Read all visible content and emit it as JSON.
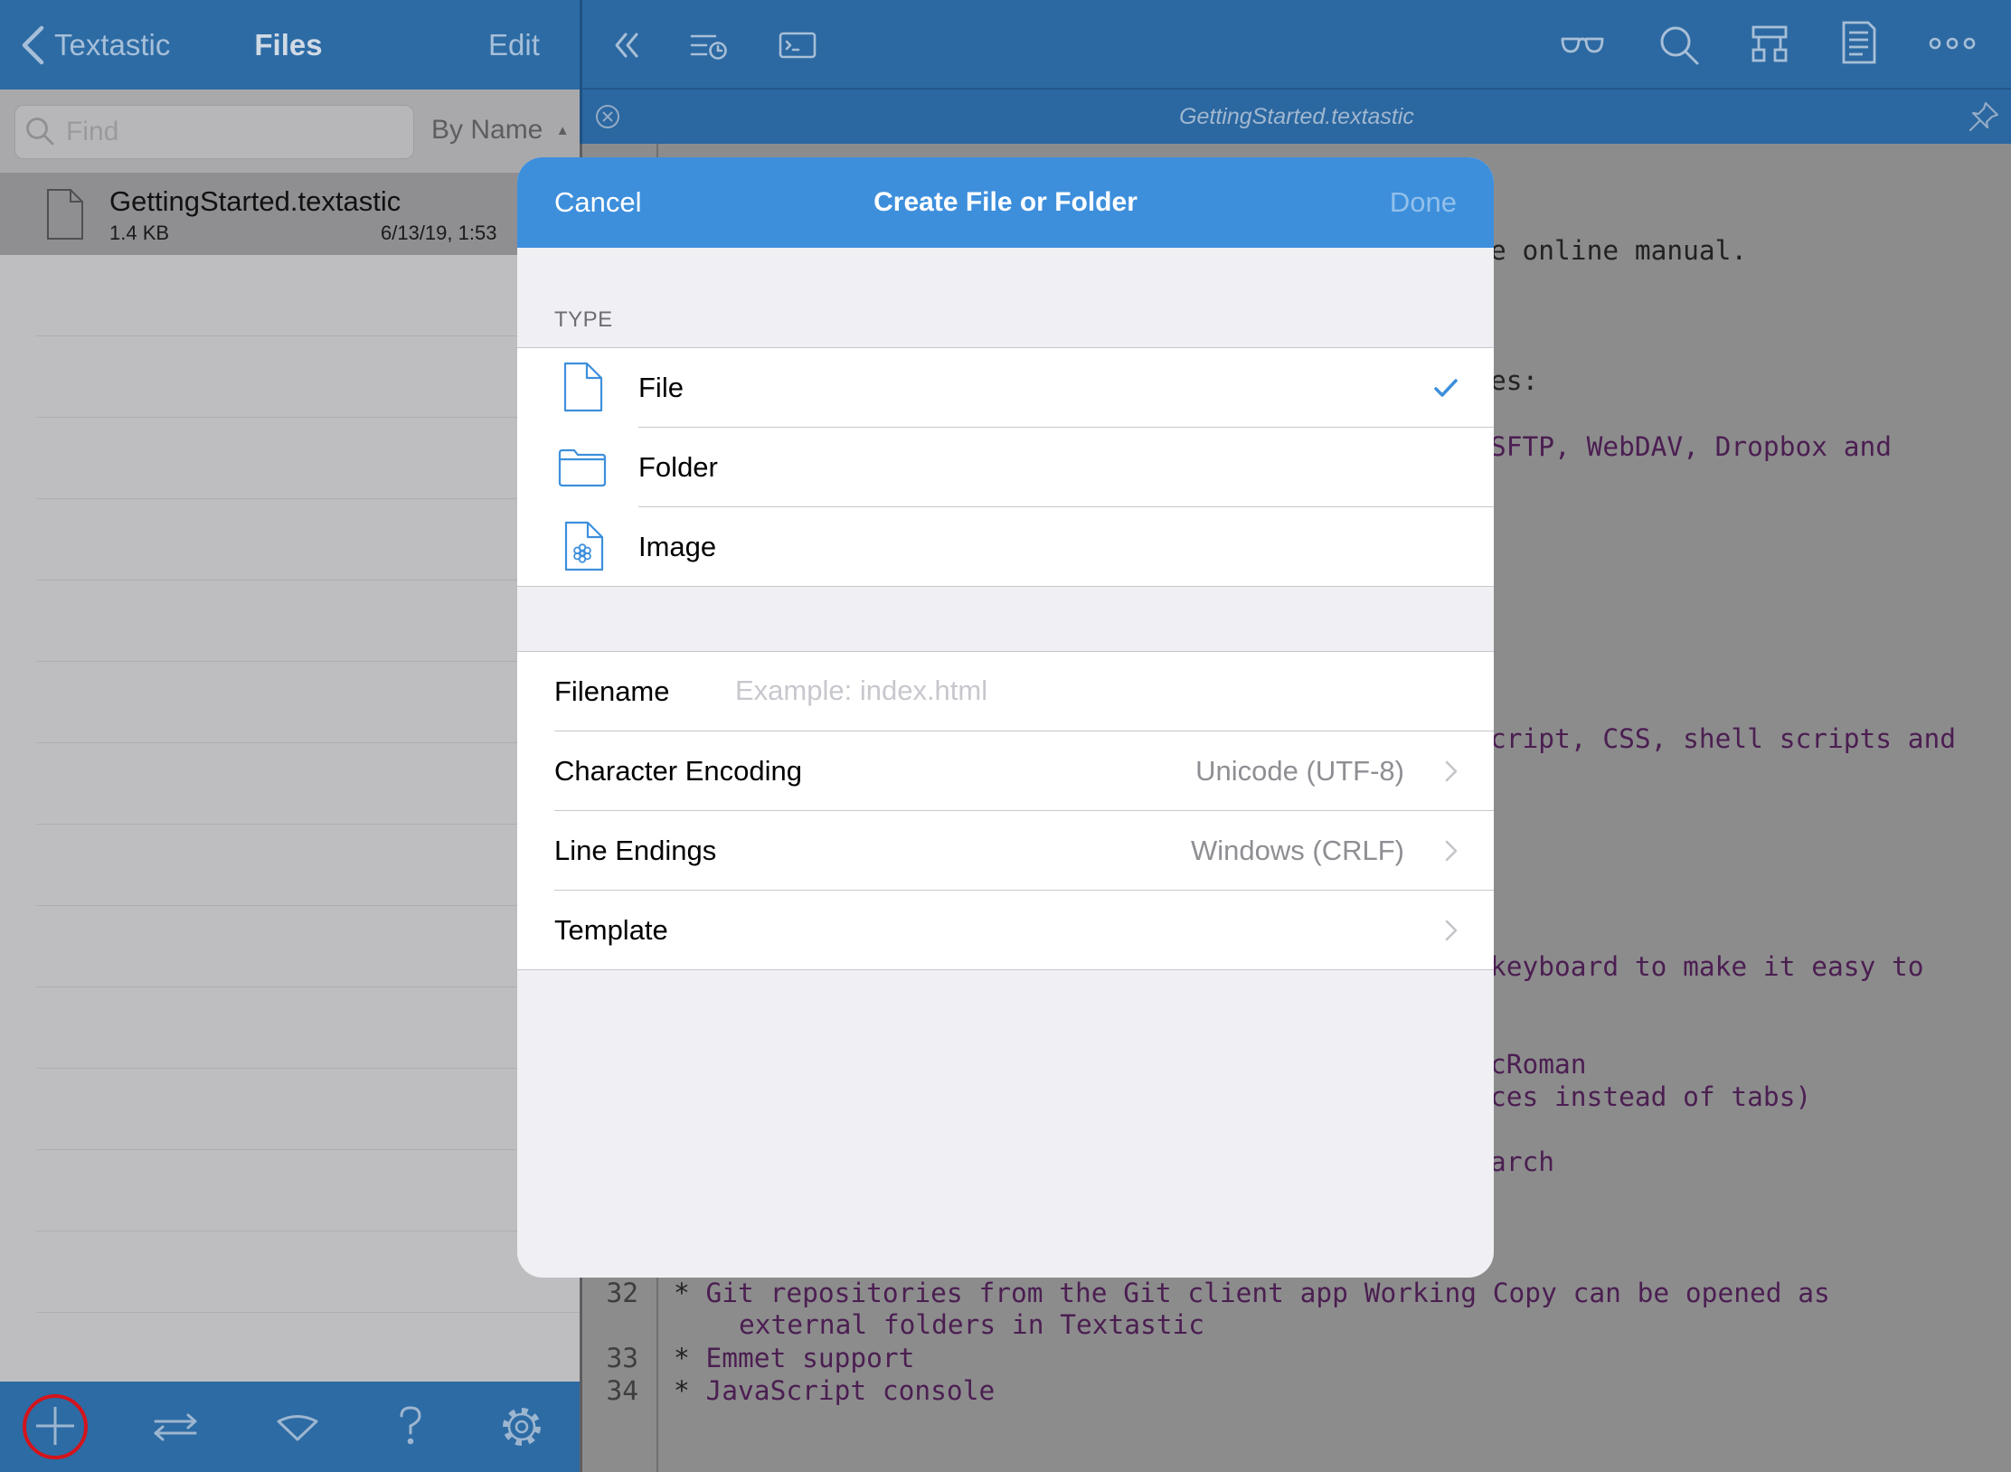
{
  "left_pane": {
    "nav": {
      "back_label": "Textastic",
      "title": "Files",
      "edit_label": "Edit"
    },
    "search": {
      "placeholder": "Find",
      "sort_label": "By Name",
      "sort_arrow": "▲"
    },
    "files": [
      {
        "name": "GettingStarted.textastic",
        "size": "1.4 KB",
        "date": "6/13/19, 1:53",
        "icon": "document-icon",
        "selected": true
      }
    ],
    "toolbar": {
      "icons": [
        "plus-icon",
        "transfer-arrows-icon",
        "snippets-icon",
        "help-icon",
        "gear-icon"
      ],
      "highlighted": "plus-icon"
    }
  },
  "editor": {
    "toolbar": {
      "icons": [
        "collapse-sidebar-icon",
        "recent-files-icon",
        "terminal-icon",
        "preview-glasses-icon",
        "search-icon",
        "symbols-icon",
        "document-info-icon",
        "more-icon"
      ]
    },
    "tab": {
      "title": "GettingStarted.textastic",
      "close_icon": "close-circle-icon",
      "pin_icon": "pin-icon"
    },
    "fragments": [
      {
        "text": "e online manual."
      },
      {
        "text": "es:"
      },
      {
        "text": "SFTP, WebDAV, Dropbox and"
      },
      {
        "text": "cript, CSS, shell scripts and"
      },
      {
        "text": "keyboard to make it easy to"
      },
      {
        "text": "cRoman"
      },
      {
        "text": "ces instead of tabs)"
      },
      {
        "text": "arch"
      }
    ],
    "lines": [
      {
        "number": "32",
        "bullet": "*",
        "text": " Git repositories from the Git client app Working Copy can be opened as",
        "wrap": "external folders in Textastic"
      },
      {
        "number": "33",
        "bullet": "*",
        "text": " Emmet support"
      },
      {
        "number": "34",
        "bullet": "*",
        "text": " JavaScript console"
      }
    ]
  },
  "dialog": {
    "cancel_label": "Cancel",
    "title": "Create File or Folder",
    "done_label": "Done",
    "done_enabled": false,
    "type_header": "TYPE",
    "types": [
      {
        "label": "File",
        "icon": "file-icon",
        "selected": true
      },
      {
        "label": "Folder",
        "icon": "folder-icon",
        "selected": false
      },
      {
        "label": "Image",
        "icon": "image-file-icon",
        "selected": false
      }
    ],
    "filename": {
      "label": "Filename",
      "placeholder": "Example: index.html",
      "value": ""
    },
    "encoding": {
      "label": "Character Encoding",
      "value": "Unicode (UTF-8)"
    },
    "line_endings": {
      "label": "Line Endings",
      "value": "Windows (CRLF)"
    },
    "template": {
      "label": "Template",
      "value": ""
    }
  },
  "colors": {
    "accent": "#3d8fdc",
    "bar": "#2d6ba4",
    "highlight": "#d4141c",
    "code_purple": "#4b1e51"
  }
}
